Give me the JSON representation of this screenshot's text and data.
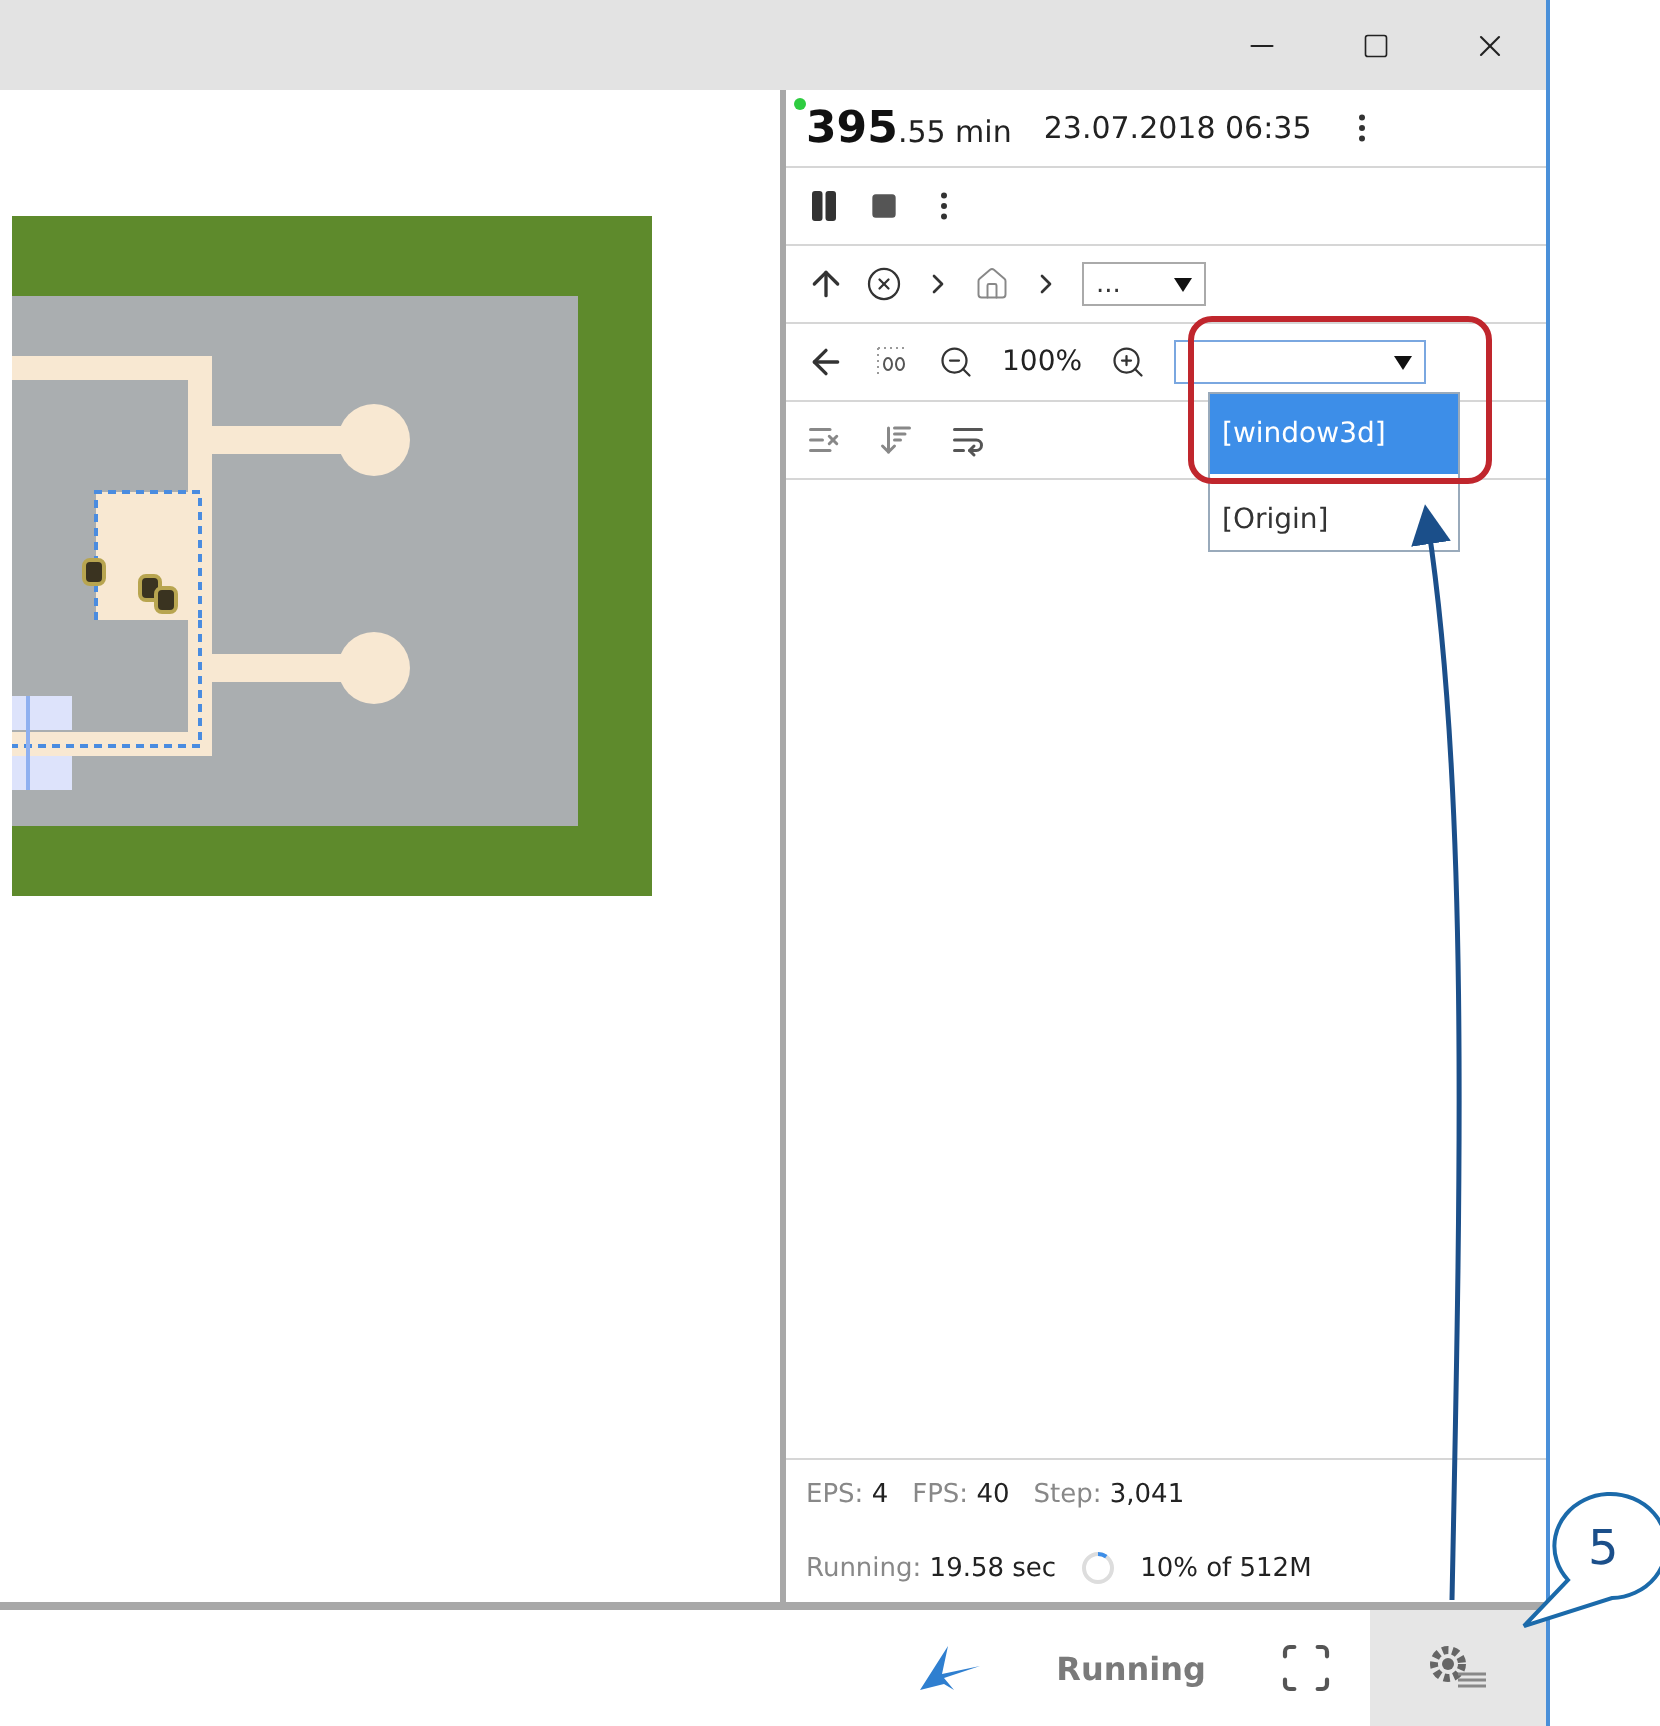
{
  "header": {
    "time_major": "395",
    "time_minor": ".55 min",
    "date": "23.07.2018 06:35"
  },
  "breadcrumb": {
    "select_value": "..."
  },
  "zoom": {
    "value": "100%"
  },
  "view_dropdown": {
    "expanded": true,
    "options": [
      {
        "label": "[window3d]",
        "selected": true
      },
      {
        "label": "[Origin]",
        "selected": false
      }
    ]
  },
  "stats": [
    {
      "label": "EPS:",
      "value": "4"
    },
    {
      "label": "FPS:",
      "value": "40"
    },
    {
      "label": "Step:",
      "value": "3,041"
    }
  ],
  "running": {
    "label": "Running:",
    "value": "19.58 sec"
  },
  "memory": {
    "text": "10% of 512M",
    "level": 0.1
  },
  "status_bar": {
    "state": "Running"
  },
  "callout": {
    "number": "5"
  }
}
